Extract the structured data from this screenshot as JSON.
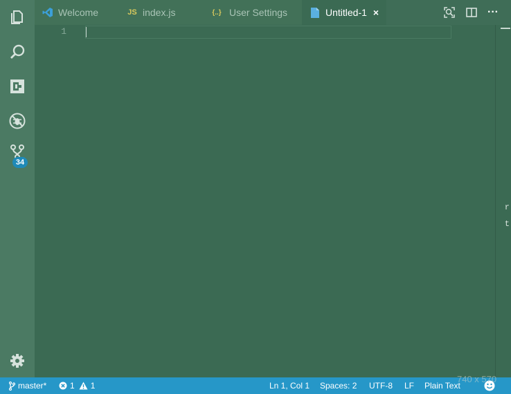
{
  "activity_bar": {
    "icons": [
      "files-icon",
      "search-icon",
      "extensions-icon",
      "debug-icon",
      "source-control-icon",
      "settings-gear-icon"
    ],
    "source_control_badge": "34"
  },
  "tabs": [
    {
      "label": "Welcome",
      "icon": "vscode-logo-icon",
      "icon_text": "",
      "active": false
    },
    {
      "label": "index.js",
      "icon": "javascript-file-icon",
      "icon_text": "JS",
      "active": false
    },
    {
      "label": "User Settings",
      "icon": "json-braces-icon",
      "icon_text": "{..}",
      "active": false
    },
    {
      "label": "Untitled-1",
      "icon": "file-icon",
      "icon_text": "",
      "active": true,
      "close": "×"
    }
  ],
  "toolbar": {
    "icons": [
      "open-changes-icon",
      "split-editor-icon",
      "more-actions-icon"
    ],
    "more_text": "···"
  },
  "editor": {
    "line_numbers": [
      "1"
    ]
  },
  "edge_glyphs": [
    "r",
    "t"
  ],
  "status_bar": {
    "branch": "master*",
    "errors": "1",
    "warnings": "1",
    "position": "Ln 1, Col 1",
    "indentation": "Spaces: 2",
    "encoding": "UTF-8",
    "eol": "LF",
    "language": "Plain Text"
  },
  "watermark": "740 x 570",
  "colors": {
    "editor_bg": "#3b6a53",
    "activity_bar_bg": "#4b7a63",
    "status_bar_bg": "#2697c8",
    "badge_bg": "#1f8ab8",
    "js_icon": "#d8c95d",
    "json_icon": "#d8c95d",
    "vscode_icon": "#3c9fd8",
    "file_icon": "#5ab0e0"
  }
}
